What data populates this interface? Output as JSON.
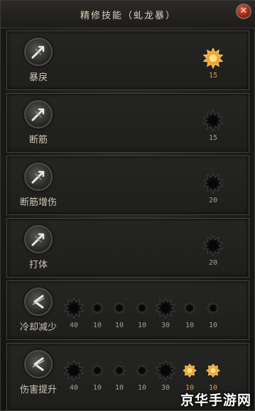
{
  "window": {
    "title": "精修技能（虬龙暴）",
    "close_glyph": "✕"
  },
  "colors": {
    "star_active": "#f0a22a",
    "star_inactive": "#111111",
    "text": "#cfc7b8"
  },
  "skills": [
    {
      "name": "暴戾",
      "icon": "arrow-icon",
      "nodes": [
        {
          "level": "15",
          "active": true,
          "big": true
        }
      ]
    },
    {
      "name": "断筋",
      "icon": "arrow-icon",
      "nodes": [
        {
          "level": "15",
          "active": false,
          "big": true
        }
      ]
    },
    {
      "name": "断筋增伤",
      "icon": "arrow-icon",
      "nodes": [
        {
          "level": "20",
          "active": false,
          "big": true
        }
      ]
    },
    {
      "name": "打体",
      "icon": "arrow-icon",
      "nodes": [
        {
          "level": "20",
          "active": false,
          "big": true
        }
      ]
    },
    {
      "name": "冷却减少",
      "icon": "cooldown-icon",
      "nodes": [
        {
          "level": "40",
          "active": false,
          "big": true
        },
        {
          "level": "10",
          "active": false,
          "big": false
        },
        {
          "level": "10",
          "active": false,
          "big": false
        },
        {
          "level": "10",
          "active": false,
          "big": false
        },
        {
          "level": "30",
          "active": false,
          "big": true
        },
        {
          "level": "10",
          "active": false,
          "big": false
        },
        {
          "level": "10",
          "active": false,
          "big": false
        }
      ]
    },
    {
      "name": "伤害提升",
      "icon": "cooldown-icon",
      "nodes": [
        {
          "level": "40",
          "active": false,
          "big": true
        },
        {
          "level": "10",
          "active": false,
          "big": false
        },
        {
          "level": "10",
          "active": false,
          "big": false
        },
        {
          "level": "10",
          "active": false,
          "big": false
        },
        {
          "level": "30",
          "active": false,
          "big": true
        },
        {
          "level": "10",
          "active": true,
          "big": false
        },
        {
          "level": "10",
          "active": true,
          "big": false
        }
      ]
    }
  ],
  "watermark": "京华手游网"
}
